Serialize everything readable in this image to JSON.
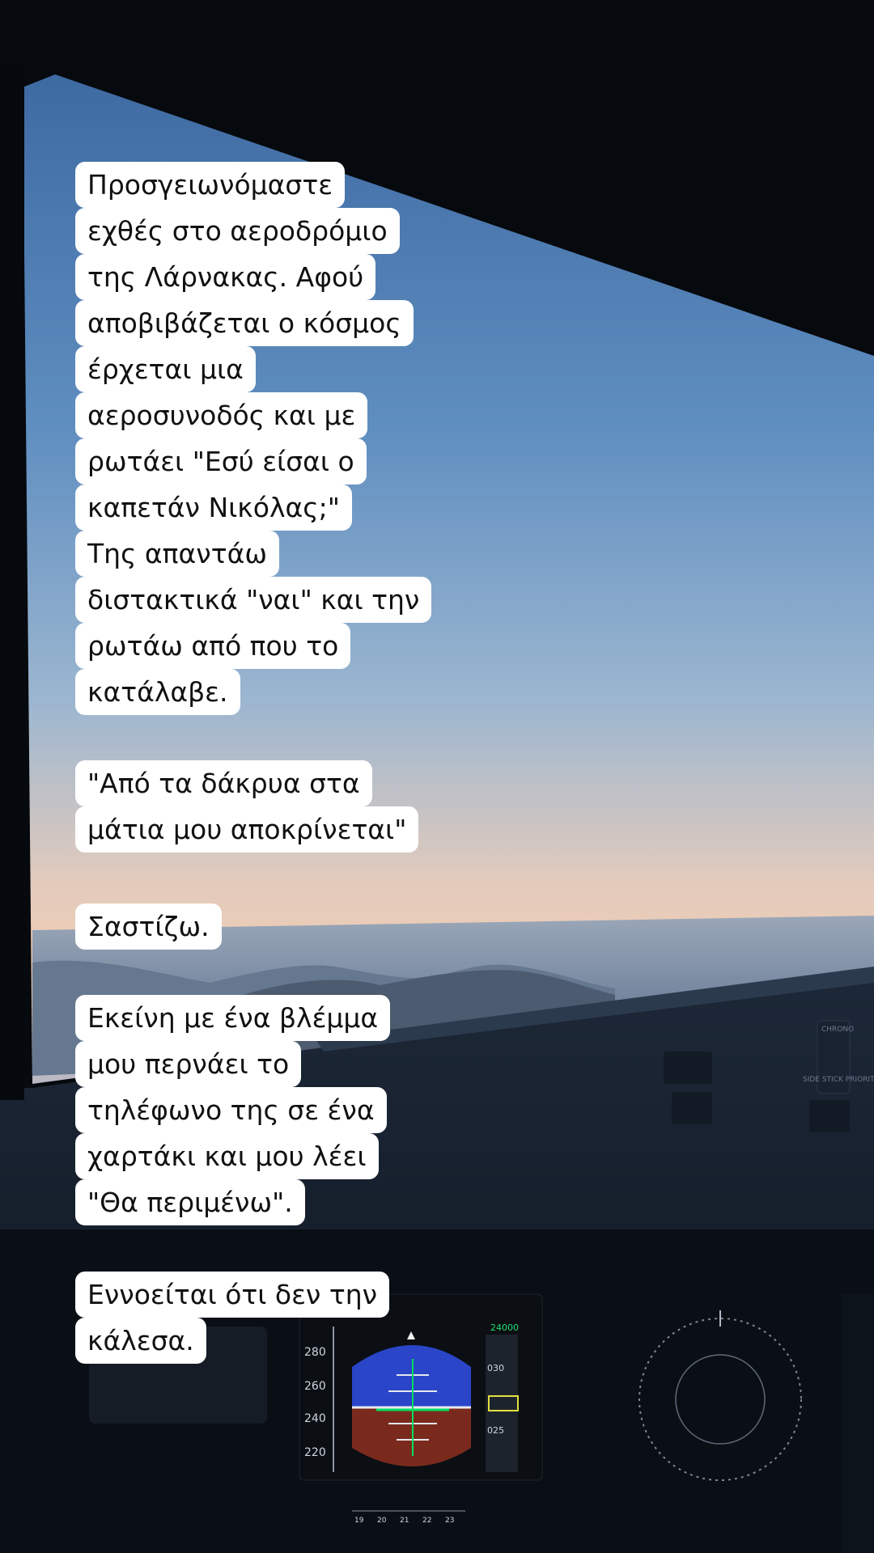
{
  "captions": [
    {
      "lines": [
        "Προσγειωνόμαστε",
        "εχθές στο αεροδρόμιο",
        "της Λάρνακας. Αφού",
        "αποβιβάζεται ο κόσμος",
        "έρχεται μια",
        "αεροσυνοδός και με",
        "ρωτάει \"Εσύ είσαι ο",
        "καπετάν Νικόλας;\"",
        "Της απαντάω",
        "διστακτικά \"ναι\" και την",
        "ρωτάω από που το",
        "κατάλαβε."
      ]
    },
    {
      "lines": [
        "\"Από τα δάκρυα στα",
        "μάτια μου αποκρίνεται\""
      ]
    },
    {
      "lines": [
        "Σαστίζω."
      ]
    },
    {
      "lines": [
        "Εκείνη με ένα βλέμμα",
        "μου περνάει το",
        "τηλέφωνο της σε ένα",
        "χαρτάκι και μου λέει",
        "\"Θα περιμένω\"."
      ]
    },
    {
      "lines": [
        "Εννοείται ότι δεν την",
        "κάλεσα."
      ]
    }
  ],
  "instruments": {
    "speed_ticks": [
      "280",
      "260",
      "240",
      "220"
    ],
    "altitude_top": "24000",
    "altitude_marks": [
      "030",
      "025"
    ],
    "heading_ticks": [
      "19",
      "20",
      "21",
      "22",
      "23"
    ],
    "panel_labels": [
      "CHRONO",
      "SIDE STICK PRIORITY"
    ]
  },
  "colors": {
    "sky_top": "#4a74a8",
    "sky_bottom": "#e8c8b2",
    "caption_bg": "#ffffff",
    "caption_text": "#111111",
    "pfd_sky": "#2a45c8",
    "pfd_ground": "#7a2a1c",
    "pfd_symbol": "#00e060"
  }
}
